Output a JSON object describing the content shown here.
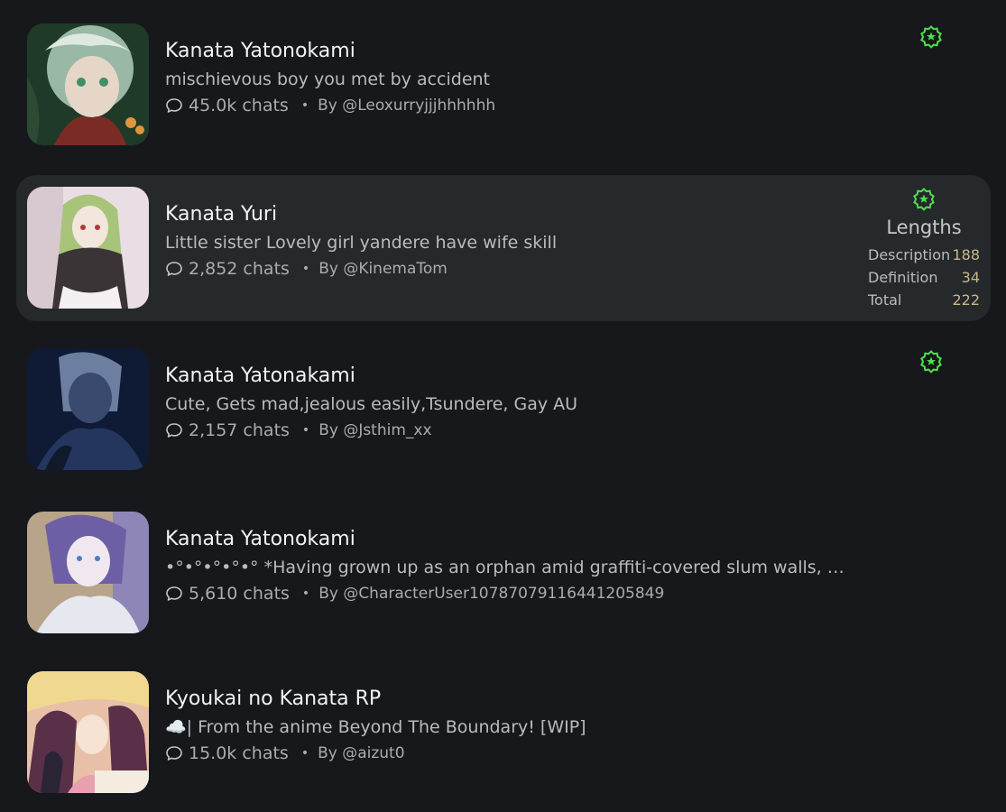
{
  "accent_color": "#4ce04a",
  "chat_icon": "speech-bubble-icon",
  "badge_icon": "star-badge-icon",
  "characters": [
    {
      "name": "Kanata Yatonokami",
      "tagline": "mischievous boy you met by accident",
      "chats": "45.0k chats",
      "author": "By @Leoxurryjjjhhhhhh",
      "avatar_colors": [
        "#2c4a34",
        "#9ab8a6",
        "#dfe8e0",
        "#7a2c24"
      ]
    },
    {
      "name": "Kanata Yuri",
      "tagline": "Little sister Lovely girl yandere have wife skill",
      "chats": "2,852 chats",
      "author": "By @KinemaTom",
      "avatar_colors": [
        "#e8dee3",
        "#a8c47a",
        "#3a3436",
        "#d7c9cf"
      ]
    },
    {
      "name": "Kanata Yatonakami",
      "tagline": "Cute, Gets mad,jealous easily,Tsundere, Gay AU",
      "chats": "2,157 chats",
      "author": "By @Jsthim_xx",
      "avatar_colors": [
        "#0f1a34",
        "#24365e",
        "#6c7fa0",
        "#111a2a"
      ]
    },
    {
      "name": "Kanata Yatonokami",
      "tagline": "•°•°•°•°•° *Having grown up as an orphan amid graffiti-covered slum walls, Kanata...",
      "chats": "5,610 chats",
      "author": "By @CharacterUser107870791164412058​49",
      "avatar_colors": [
        "#8e86b6",
        "#e6e8f0",
        "#6d5fa6",
        "#b7a48a"
      ]
    },
    {
      "name": "Kyoukai no Kanata RP",
      "tagline": "☁️| From the anime Beyond The Boundary! [WIP]",
      "chats": "15.0k chats",
      "author": "By @aizut0",
      "avatar_colors": [
        "#e8c0a8",
        "#5a3048",
        "#f0d890",
        "#2a2436"
      ]
    }
  ],
  "lengths_panel": {
    "title": "Lengths",
    "rows": [
      {
        "label": "Description",
        "value": "188"
      },
      {
        "label": "Definition",
        "value": "34"
      },
      {
        "label": "Total",
        "value": "222"
      }
    ]
  }
}
